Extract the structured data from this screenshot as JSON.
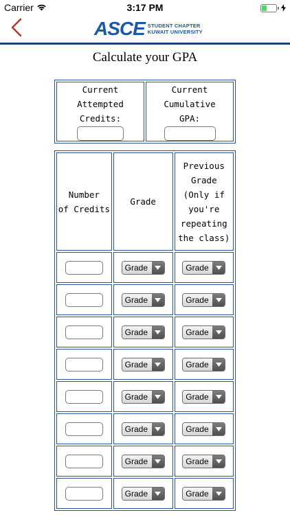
{
  "status_bar": {
    "carrier": "Carrier",
    "time": "3:17 PM"
  },
  "nav": {
    "back_icon": "chevron-left-icon",
    "logo_text": "ASCE",
    "logo_sub_line1": "STUDENT CHAPTER",
    "logo_sub_line2": "KUWAIT UNIVERSITY"
  },
  "page": {
    "title": "Calculate your GPA"
  },
  "summary": {
    "attempted_credits_label_line1": "Current Attempted",
    "attempted_credits_label_line2": "Credits:",
    "attempted_credits_value": "",
    "cumulative_gpa_label_line1": "Current Cumulative",
    "cumulative_gpa_label_line2": "GPA:",
    "cumulative_gpa_value": ""
  },
  "courses": {
    "headers": {
      "credits_line1": "Number",
      "credits_line2": "of Credits",
      "grade": "Grade",
      "previous_line1": "Previous",
      "previous_line2": "Grade",
      "previous_line3": "(Only if",
      "previous_line4": "you're",
      "previous_line5": "repeating",
      "previous_line6": "the class)"
    },
    "rows": [
      {
        "credits": "",
        "grade": "Grade",
        "previous_grade": "Grade"
      },
      {
        "credits": "",
        "grade": "Grade",
        "previous_grade": "Grade"
      },
      {
        "credits": "",
        "grade": "Grade",
        "previous_grade": "Grade"
      },
      {
        "credits": "",
        "grade": "Grade",
        "previous_grade": "Grade"
      },
      {
        "credits": "",
        "grade": "Grade",
        "previous_grade": "Grade"
      },
      {
        "credits": "",
        "grade": "Grade",
        "previous_grade": "Grade"
      },
      {
        "credits": "",
        "grade": "Grade",
        "previous_grade": "Grade"
      },
      {
        "credits": "",
        "grade": "Grade",
        "previous_grade": "Grade"
      }
    ]
  },
  "colors": {
    "brand_blue": "#1b58a7",
    "table_border": "#2a5397",
    "back_arrow": "#a83a32",
    "battery": "#4cd964"
  }
}
